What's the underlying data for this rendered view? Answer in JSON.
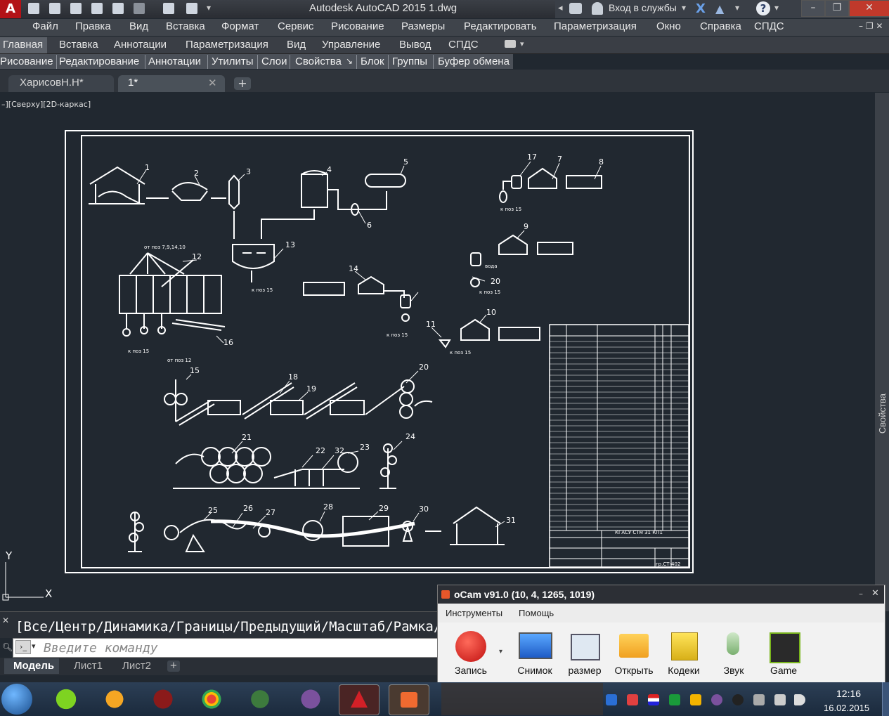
{
  "window": {
    "title": "Autodesk AutoCAD 2015    1.dwg",
    "login": "Вход в службы",
    "help_icon": "question-icon"
  },
  "menu": [
    "Файл",
    "Правка",
    "Вид",
    "Вставка",
    "Формат",
    "Сервис",
    "Рисование",
    "Размеры",
    "Редактировать",
    "Параметризация",
    "Окно",
    "Справка",
    "СПДС"
  ],
  "ribbon_tabs": [
    "Главная",
    "Вставка",
    "Аннотации",
    "Параметризация",
    "Вид",
    "Управление",
    "Вывод",
    "СПДС"
  ],
  "panels": [
    "Рисование",
    "Редактирование",
    "Аннотации",
    "Утилиты",
    "Слои",
    "Свойства",
    "Блок",
    "Группы",
    "Буфер обмена"
  ],
  "file_tabs": [
    "ХарисовН.Н*",
    "1*"
  ],
  "viewport": {
    "label": "–][Сверху][2D-каркас]",
    "side_panel": "Свойства",
    "axis_y": "Y",
    "axis_x": "X"
  },
  "drawing": {
    "position_numbers": [
      "1",
      "2",
      "3",
      "4",
      "5",
      "6",
      "7",
      "8",
      "9",
      "10",
      "11",
      "12",
      "13",
      "14",
      "15",
      "16",
      "17",
      "18",
      "19",
      "20",
      "21",
      "22",
      "23",
      "24",
      "25",
      "26",
      "27",
      "28",
      "29",
      "30",
      "31",
      "32"
    ],
    "notes": [
      "к поз 15",
      "от поз 7,9,14,10",
      "от поз 12",
      "вода"
    ],
    "stamp_code": "КГАСУ СТм 31 КП1",
    "stamp_group": "гр.СТ-402"
  },
  "command": {
    "history": "[Все/Центр/Динамика/Границы/Предыдущий/Масштаб/Рамка/Об",
    "placeholder": "Введите команду"
  },
  "layout_tabs": [
    "Модель",
    "Лист1",
    "Лист2"
  ],
  "ocam": {
    "title": "oCam v91.0 (10, 4, 1265, 1019)",
    "menu": [
      "Инструменты",
      "Помощь"
    ],
    "buttons": [
      "Запись",
      "Снимок",
      "размер",
      "Открыть",
      "Кодеки",
      "Звук",
      "Game"
    ]
  },
  "taskbar": {
    "time": "12:16",
    "date": "16.02.2015",
    "apps": [
      "start-orb-icon",
      "utorrent-icon",
      "vlc-icon",
      "winrar-icon",
      "chrome-icon",
      "monitor-icon",
      "viber-icon",
      "autocad-icon",
      "ocam-icon"
    ]
  },
  "colors": {
    "viewport_bg": "#212830",
    "title_bg": "#2a2d33",
    "autocad_red": "#b31217"
  }
}
